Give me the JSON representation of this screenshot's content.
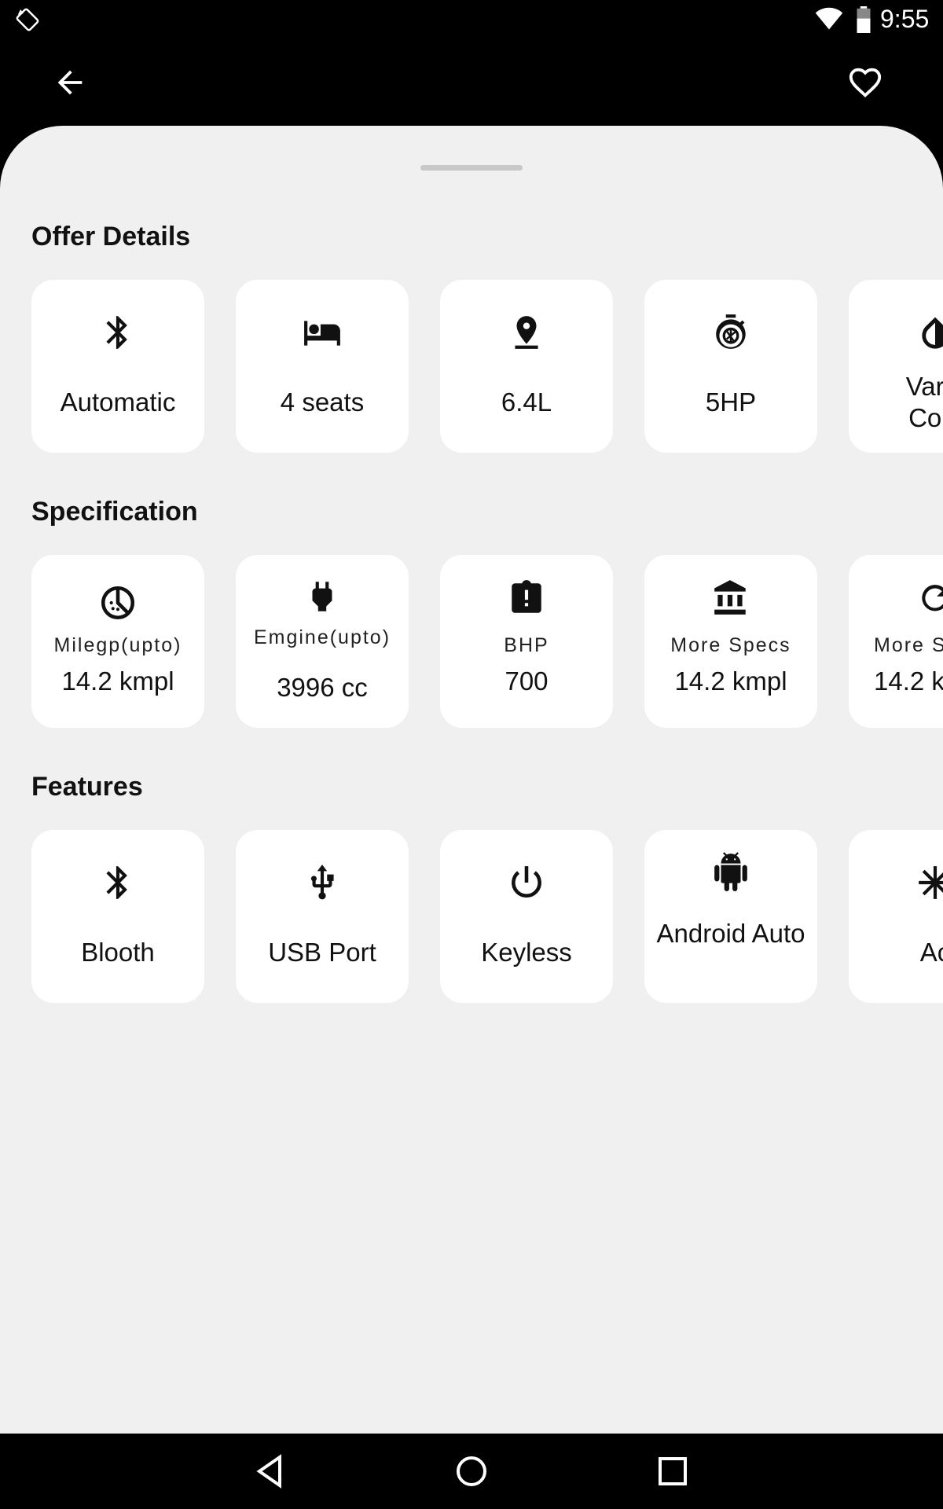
{
  "status_bar": {
    "time": "9:55"
  },
  "offer_details": {
    "title": "Offer Details",
    "items": [
      {
        "label": "Automatic",
        "icon": "bluetooth-icon"
      },
      {
        "label": "4 seats",
        "icon": "bed-icon"
      },
      {
        "label": "6.4L",
        "icon": "pin-drop-icon"
      },
      {
        "label": "5HP",
        "icon": "shutter-speed-icon"
      },
      {
        "label": "Varia\nColo",
        "icon": "opacity-icon"
      }
    ]
  },
  "specification": {
    "title": "Specification",
    "items": [
      {
        "label": "Milegp(upto)",
        "value": "14.2 kmpl",
        "icon": "timelapse-icon"
      },
      {
        "label": "Emgine(upto)",
        "value": "3996 cc",
        "icon": "power-plug-icon"
      },
      {
        "label": "BHP",
        "value": "700",
        "icon": "alert-clipboard-icon"
      },
      {
        "label": "More Specs",
        "value": "14.2 kmpl",
        "icon": "bank-icon"
      },
      {
        "label": "More S",
        "value": "14.2 k",
        "icon": "refresh-icon"
      }
    ]
  },
  "features": {
    "title": "Features",
    "items": [
      {
        "label": "Blooth",
        "icon": "bluetooth-icon"
      },
      {
        "label": "USB Port",
        "icon": "usb-icon"
      },
      {
        "label": "Keyless",
        "icon": "power-icon"
      },
      {
        "label": "Android Auto",
        "icon": "android-icon"
      },
      {
        "label": "Ac",
        "icon": "snowflake-icon"
      }
    ]
  }
}
